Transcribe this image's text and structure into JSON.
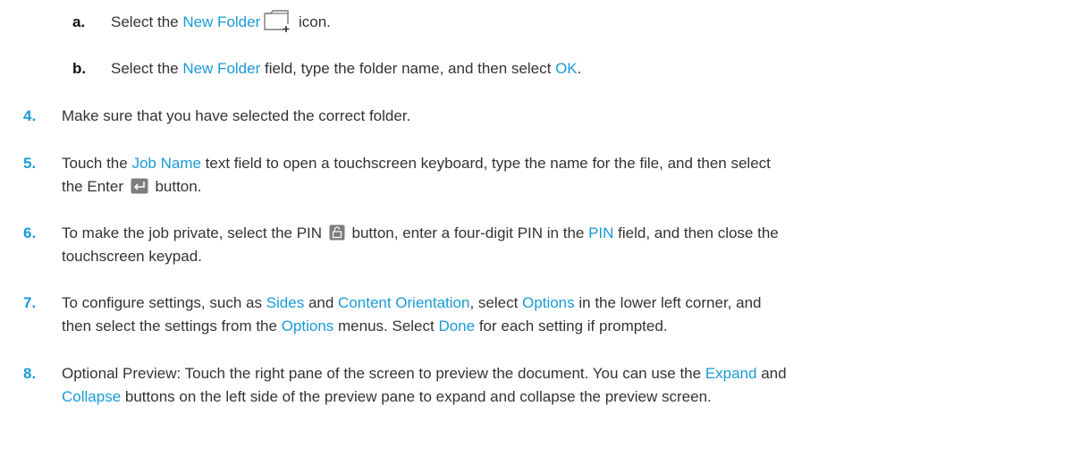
{
  "steps": {
    "a": {
      "num": "a.",
      "t1": "Select the ",
      "link1": "New Folder",
      "t2": " icon."
    },
    "b": {
      "num": "b.",
      "t1": "Select the ",
      "link1": "New Folder",
      "t2": " field, type the folder name, and then select ",
      "link2": "OK",
      "t3": "."
    },
    "s4": {
      "num": "4.",
      "t1": "Make sure that you have selected the correct folder."
    },
    "s5": {
      "num": "5.",
      "t1": "Touch the ",
      "link1": "Job Name",
      "t2": " text field to open a touchscreen keyboard, type the name for the file, and then select",
      "t3": "the Enter ",
      "t4": " button."
    },
    "s6": {
      "num": "6.",
      "t1": "To make the job private, select the PIN ",
      "t2": " button, enter a four-digit PIN in the ",
      "link1": "PIN",
      "t3": " field, and then close the",
      "t4": "touchscreen keypad."
    },
    "s7": {
      "num": "7.",
      "t1": "To configure settings, such as ",
      "link1": "Sides",
      "t2": " and ",
      "link2": "Content Orientation",
      "t3": ", select ",
      "link3": "Options",
      "t4": " in the lower left corner, and",
      "t5": "then select the settings from the ",
      "link4": "Options",
      "t6": " menus. Select ",
      "link5": "Done",
      "t7": " for each setting if prompted."
    },
    "s8": {
      "num": "8.",
      "t1": "Optional Preview: Touch the right pane of the screen to preview the document. You can use the ",
      "link1": "Expand",
      "t2": " and",
      "link2": "Collapse",
      "t3": " buttons on the left side of the preview pane to expand and collapse the preview screen."
    }
  },
  "icons": {
    "new_folder": "new-folder-icon",
    "enter": "enter-icon",
    "pin": "pin-lock-icon"
  },
  "colors": {
    "link": "#1a9ad6",
    "text": "#333333",
    "step_number": "#1a9ad6"
  }
}
